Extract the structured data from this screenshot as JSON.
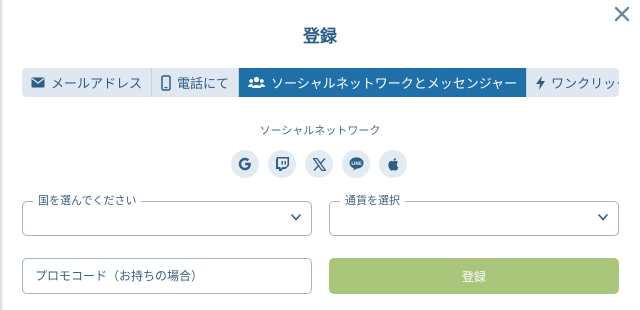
{
  "dialog": {
    "title": "登録",
    "close_icon": "close-icon"
  },
  "tabs": [
    {
      "label": "メールアドレス",
      "icon": "envelope-icon",
      "active": false
    },
    {
      "label": "電話にて",
      "icon": "phone-icon",
      "active": false
    },
    {
      "label": "ソーシャルネットワークとメッセンジャー",
      "icon": "users-icon",
      "active": true
    },
    {
      "label": "ワンクリック",
      "icon": "lightning-icon",
      "active": false
    }
  ],
  "social": {
    "label": "ソーシャルネットワーク",
    "providers": [
      {
        "name": "google",
        "icon": "google-icon"
      },
      {
        "name": "twitch",
        "icon": "twitch-icon"
      },
      {
        "name": "x",
        "icon": "x-icon"
      },
      {
        "name": "line",
        "icon": "line-icon"
      },
      {
        "name": "apple",
        "icon": "apple-icon"
      }
    ]
  },
  "form": {
    "country": {
      "label": "国を選んでください",
      "value": ""
    },
    "currency": {
      "label": "通貨を選択",
      "value": ""
    },
    "promo": {
      "placeholder": "プロモコード（お持ちの場合）"
    },
    "submit_label": "登録"
  },
  "colors": {
    "primary": "#1f6fa8",
    "text": "#2d5d89",
    "tab_bg": "#dfe8f0",
    "submit_bg": "#a9c67a",
    "field_border": "#9fb6ca"
  }
}
